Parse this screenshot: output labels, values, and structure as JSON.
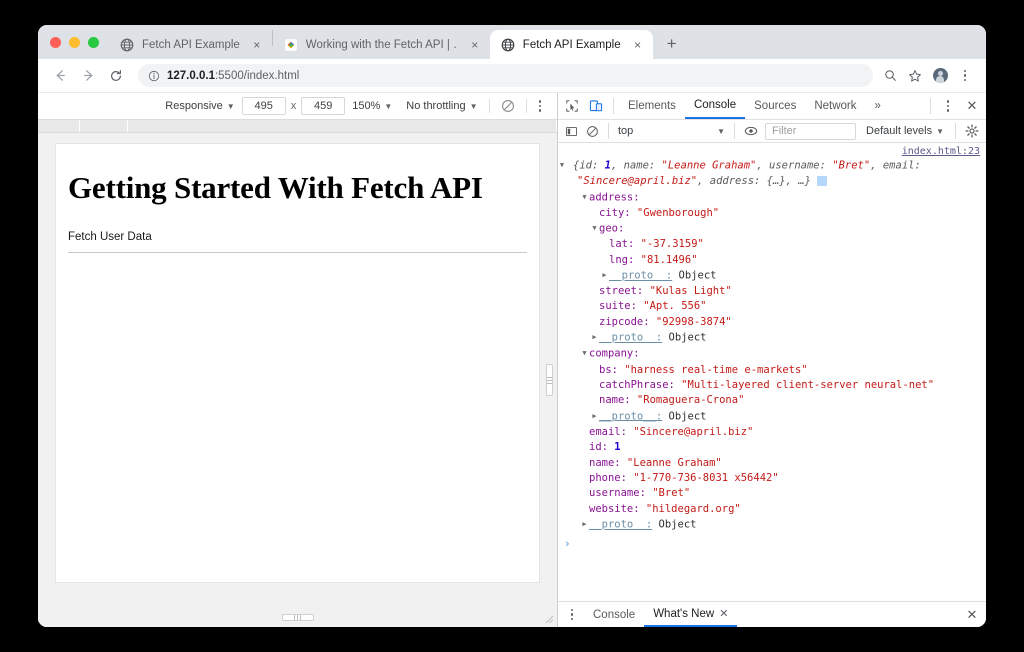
{
  "browser": {
    "tabs": [
      {
        "label": "Fetch API Example",
        "favicon": "globe-icon",
        "active": false
      },
      {
        "label": "Working with the Fetch API | …",
        "favicon": "google-icon",
        "active": false
      },
      {
        "label": "Fetch API Example",
        "favicon": "globe-icon",
        "active": true
      }
    ],
    "new_tab_label": "+",
    "close_label": "×",
    "address": {
      "host": "127.0.0.1",
      "path": ":5500/index.html"
    },
    "nav": {
      "back": "←",
      "forward": "→",
      "reload": "↻"
    },
    "toolbar_icons": [
      "search-icon",
      "bookmark-star-icon",
      "avatar",
      "chrome-menu-icon"
    ]
  },
  "device_toolbar": {
    "device": "Responsive",
    "width": "495",
    "times": "x",
    "height": "459",
    "zoom": "150%",
    "throttling": "No throttling",
    "rotate_icon": "rotate-icon",
    "more_icon": "more-options-icon"
  },
  "page": {
    "heading": "Getting Started With Fetch API",
    "button": "Fetch User Data"
  },
  "devtools": {
    "left_icons": [
      "inspect-element-icon",
      "device-toolbar-icon"
    ],
    "tabs": [
      "Elements",
      "Console",
      "Sources",
      "Network"
    ],
    "selected_tab": "Console",
    "more_tabs": "»",
    "menu_icon": "devtools-menu-icon",
    "close_icon": "✕",
    "filter_bar": {
      "sidebar_icon": "console-sidebar-icon",
      "clear_icon": "clear-console-icon",
      "context": "top",
      "eye_icon": "live-expression-icon",
      "filter_placeholder": "Filter",
      "levels": "Default levels",
      "settings_icon": "settings-gear-icon"
    },
    "source_link": "index.html:23",
    "log": {
      "preview": {
        "open": "{",
        "k_id": "id:",
        "v_id": " 1",
        "sep1": ", ",
        "k_name": "name:",
        "v_name": " \"Leanne Graham\"",
        "sep2": ", ",
        "k_username": "username:",
        "v_username": " \"Bret\"",
        "sep3": ", ",
        "k_email": "email:",
        "v_email": " \"Sincere@april.biz\"",
        "sep4": ", ",
        "k_address": "address:",
        "v_address": " {…}, …}",
        "badge": "i"
      },
      "lines": [
        {
          "indent": 1,
          "arrow": "down",
          "key": "address:",
          "value": "",
          "type": "obj"
        },
        {
          "indent": 2,
          "arrow": "blank",
          "key": "city:",
          "value": " \"Gwenborough\"",
          "type": "str"
        },
        {
          "indent": 2,
          "arrow": "down",
          "key": "geo:",
          "value": "",
          "type": "obj"
        },
        {
          "indent": 3,
          "arrow": "blank",
          "key": "lat:",
          "value": " \"-37.3159\"",
          "type": "str"
        },
        {
          "indent": 3,
          "arrow": "blank",
          "key": "lng:",
          "value": " \"81.1496\"",
          "type": "str"
        },
        {
          "indent": 3,
          "arrow": "right",
          "key": "__proto__:",
          "value": " Object",
          "type": "proto"
        },
        {
          "indent": 2,
          "arrow": "blank",
          "key": "street:",
          "value": " \"Kulas Light\"",
          "type": "str"
        },
        {
          "indent": 2,
          "arrow": "blank",
          "key": "suite:",
          "value": " \"Apt. 556\"",
          "type": "str"
        },
        {
          "indent": 2,
          "arrow": "blank",
          "key": "zipcode:",
          "value": " \"92998-3874\"",
          "type": "str"
        },
        {
          "indent": 2,
          "arrow": "right",
          "key": "__proto__:",
          "value": " Object",
          "type": "proto"
        },
        {
          "indent": 1,
          "arrow": "down",
          "key": "company:",
          "value": "",
          "type": "obj"
        },
        {
          "indent": 2,
          "arrow": "blank",
          "key": "bs:",
          "value": " \"harness real-time e-markets\"",
          "type": "str"
        },
        {
          "indent": 2,
          "arrow": "blank",
          "key": "catchPhrase:",
          "value": " \"Multi-layered client-server neural-net\"",
          "type": "str"
        },
        {
          "indent": 2,
          "arrow": "blank",
          "key": "name:",
          "value": " \"Romaguera-Crona\"",
          "type": "str"
        },
        {
          "indent": 2,
          "arrow": "right",
          "key": "__proto__:",
          "value": " Object",
          "type": "proto"
        },
        {
          "indent": 1,
          "arrow": "blank",
          "key": "email:",
          "value": " \"Sincere@april.biz\"",
          "type": "str"
        },
        {
          "indent": 1,
          "arrow": "blank",
          "key": "id:",
          "value": " 1",
          "type": "num"
        },
        {
          "indent": 1,
          "arrow": "blank",
          "key": "name:",
          "value": " \"Leanne Graham\"",
          "type": "str"
        },
        {
          "indent": 1,
          "arrow": "blank",
          "key": "phone:",
          "value": " \"1-770-736-8031 x56442\"",
          "type": "str"
        },
        {
          "indent": 1,
          "arrow": "blank",
          "key": "username:",
          "value": " \"Bret\"",
          "type": "str"
        },
        {
          "indent": 1,
          "arrow": "blank",
          "key": "website:",
          "value": " \"hildegard.org\"",
          "type": "str"
        },
        {
          "indent": 1,
          "arrow": "right",
          "key": "__proto__:",
          "value": " Object",
          "type": "proto"
        }
      ],
      "prompt": "›"
    },
    "drawer": {
      "menu_icon": "drawer-menu-icon",
      "tabs": [
        {
          "label": "Console",
          "selected": false,
          "closable": false
        },
        {
          "label": "What's New",
          "selected": true,
          "closable": true
        }
      ],
      "close_icon": "✕",
      "tab_close": "✕"
    }
  },
  "colors": {
    "accent": "#1a73e8",
    "string": "#c41a16",
    "number": "#1c00cf",
    "property": "#881391"
  }
}
